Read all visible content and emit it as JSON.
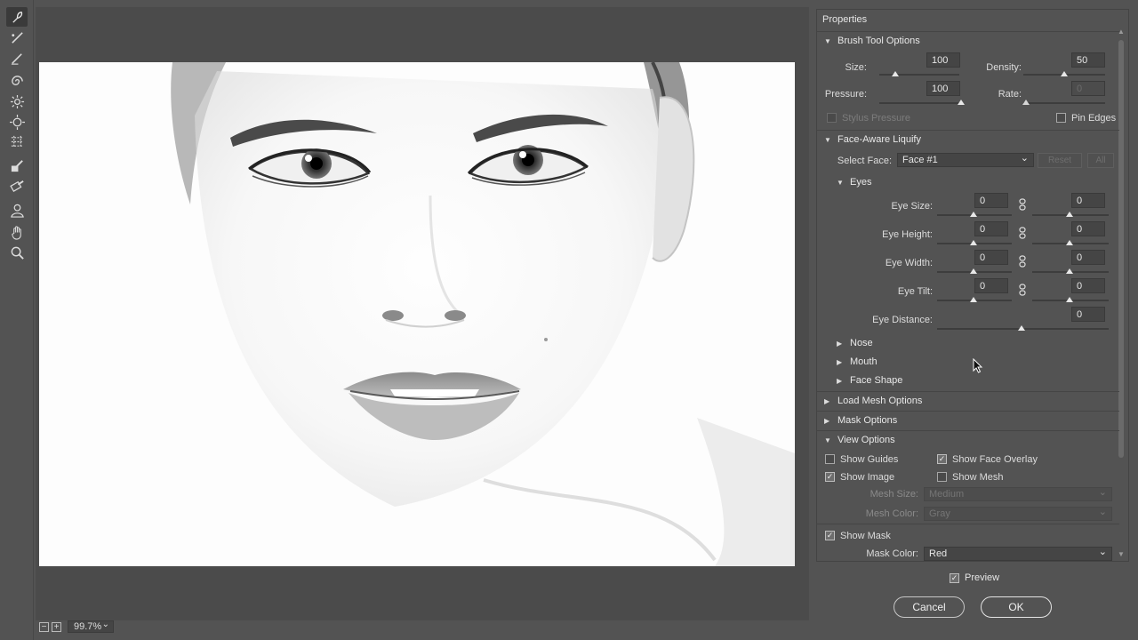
{
  "toolbar": {
    "tools": [
      {
        "name": "forward-warp-tool-icon",
        "active": true
      },
      {
        "name": "reconstruct-tool-icon"
      },
      {
        "name": "smooth-tool-icon"
      },
      {
        "name": "twirl-clockwise-tool-icon"
      },
      {
        "name": "pucker-tool-icon"
      },
      {
        "name": "bloat-tool-icon"
      },
      {
        "name": "push-left-tool-icon"
      },
      {
        "name": "freeze-mask-tool-icon"
      },
      {
        "name": "thaw-mask-tool-icon"
      },
      {
        "name": "face-tool-icon"
      },
      {
        "name": "hand-tool-icon"
      },
      {
        "name": "zoom-tool-icon"
      }
    ]
  },
  "canvas": {
    "zoom_out": "−",
    "zoom_in": "+",
    "zoom_value": "99.7%",
    "zoom_chevron": "⌄"
  },
  "properties": {
    "title": "Properties",
    "brush": {
      "header": "Brush Tool Options",
      "size_label": "Size:",
      "size_value": "100",
      "size_level": 0.2,
      "density_label": "Density:",
      "density_value": "50",
      "density_level": 0.5,
      "pressure_label": "Pressure:",
      "pressure_value": "100",
      "pressure_level": 1.0,
      "rate_label": "Rate:",
      "rate_value": "0",
      "stylus_label": "Stylus Pressure",
      "stylus_checked": false,
      "pin_edges_label": "Pin Edges",
      "pin_edges_checked": false
    },
    "face": {
      "header": "Face-Aware Liquify",
      "select_face_label": "Select Face:",
      "select_face_value": "Face #1",
      "reset_label": "Reset",
      "all_label": "All",
      "eyes_header": "Eyes",
      "eye_size_label": "Eye Size:",
      "eye_size_left": "0",
      "eye_size_right": "0",
      "eye_height_label": "Eye Height:",
      "eye_height_left": "0",
      "eye_height_right": "0",
      "eye_width_label": "Eye Width:",
      "eye_width_left": "0",
      "eye_width_right": "0",
      "eye_tilt_label": "Eye Tilt:",
      "eye_tilt_left": "0",
      "eye_tilt_right": "0",
      "eye_distance_label": "Eye Distance:",
      "eye_distance_value": "0",
      "nose_label": "Nose",
      "mouth_label": "Mouth",
      "face_shape_label": "Face Shape"
    },
    "load_mesh_label": "Load Mesh Options",
    "mask_options_label": "Mask Options",
    "view": {
      "header": "View Options",
      "show_guides_label": "Show Guides",
      "show_guides_checked": false,
      "show_face_overlay_label": "Show Face Overlay",
      "show_face_overlay_checked": true,
      "show_image_label": "Show Image",
      "show_image_checked": true,
      "show_mesh_label": "Show Mesh",
      "show_mesh_checked": false,
      "mesh_size_label": "Mesh Size:",
      "mesh_size_value": "Medium",
      "mesh_color_label": "Mesh Color:",
      "mesh_color_value": "Gray",
      "show_mask_label": "Show Mask",
      "show_mask_checked": true,
      "mask_color_label": "Mask Color:",
      "mask_color_value": "Red"
    }
  },
  "dialog": {
    "preview_label": "Preview",
    "preview_checked": true,
    "cancel_label": "Cancel",
    "ok_label": "OK"
  },
  "glyphs": {
    "check": "✓",
    "expanded": "▼",
    "collapsed": "▶",
    "chevron": "⌄"
  }
}
